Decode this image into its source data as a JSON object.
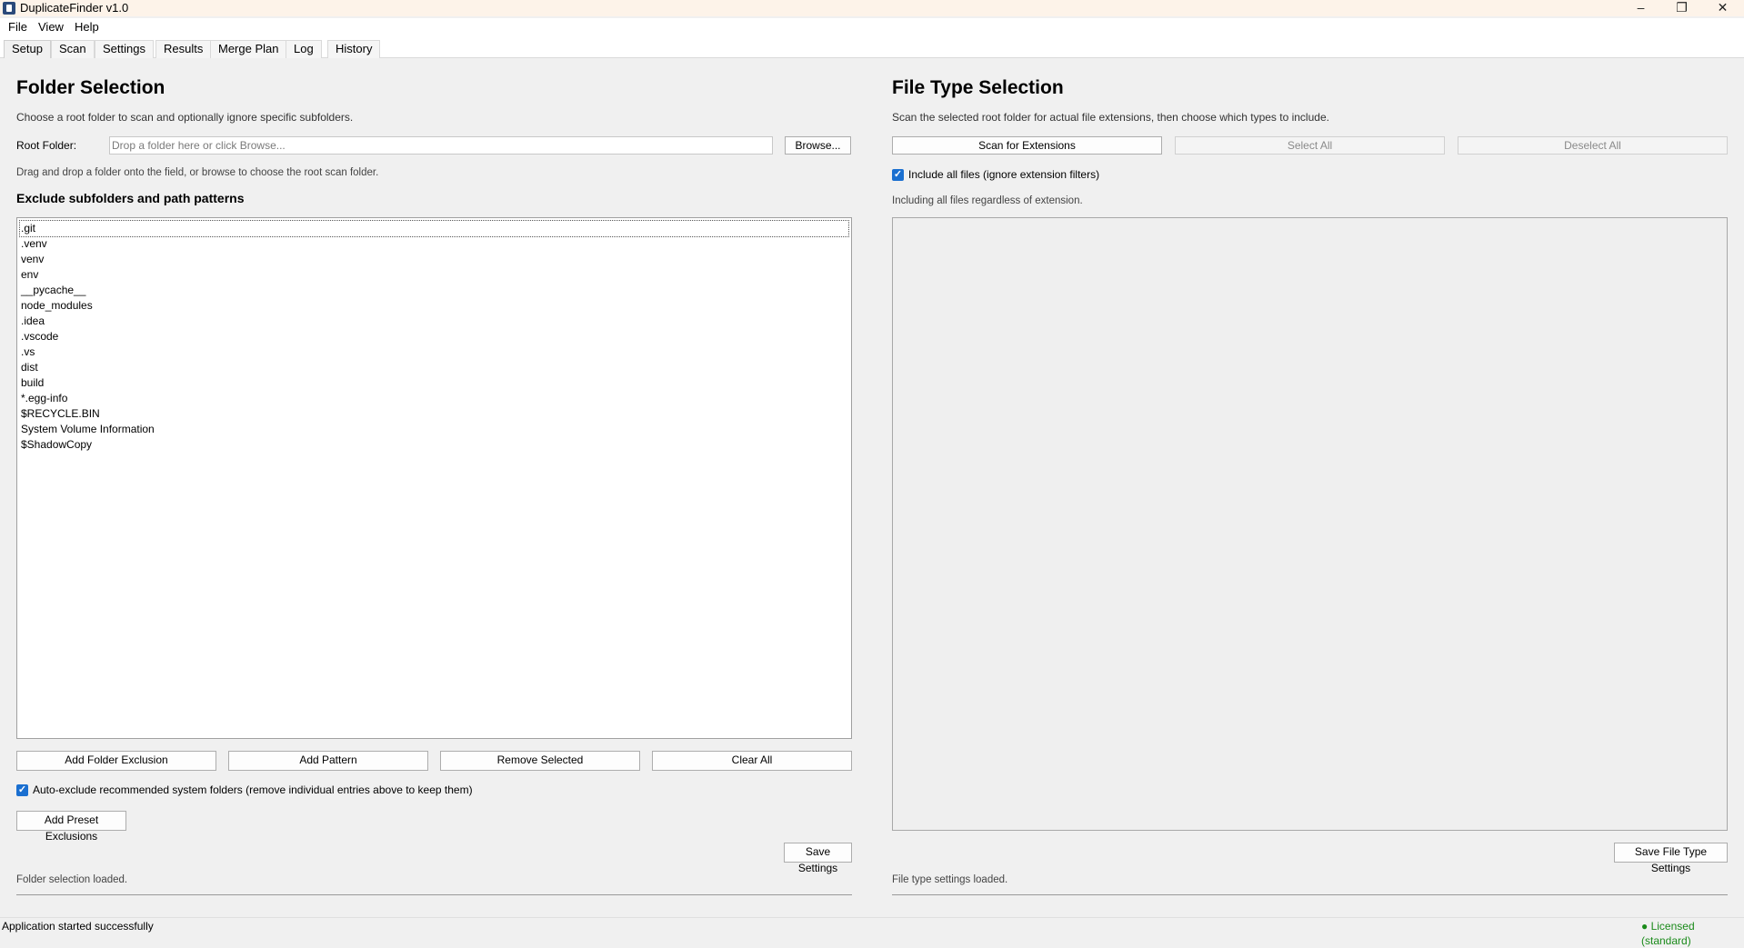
{
  "window": {
    "title": "DuplicateFinder v1.0",
    "minimize": "–",
    "maximize": "❐",
    "close": "✕"
  },
  "menu": {
    "file": "File",
    "view": "View",
    "help": "Help"
  },
  "tabs": [
    {
      "label": "Setup"
    },
    {
      "label": "Scan"
    },
    {
      "label": "Settings"
    },
    {
      "label": "Results"
    },
    {
      "label": "Merge Plan"
    },
    {
      "label": "Log"
    },
    {
      "label": "History"
    }
  ],
  "folder": {
    "heading": "Folder Selection",
    "description": "Choose a root folder to scan and optionally ignore specific subfolders.",
    "root_label": "Root Folder:",
    "root_placeholder": "Drop a folder here or click Browse...",
    "browse": "Browse...",
    "hint": "Drag and drop a folder onto the field, or browse to choose the root scan folder.",
    "exclude_heading": "Exclude subfolders and path patterns",
    "exclusions": [
      ".git",
      ".venv",
      "venv",
      "env",
      "__pycache__",
      "node_modules",
      ".idea",
      ".vscode",
      ".vs",
      "dist",
      "build",
      "*.egg-info",
      "$RECYCLE.BIN",
      "System Volume Information",
      "$ShadowCopy"
    ],
    "add_folder": "Add Folder Exclusion",
    "add_pattern": "Add Pattern",
    "remove_selected": "Remove Selected",
    "clear_all": "Clear All",
    "auto_exclude": "Auto-exclude recommended system folders (remove individual entries above to keep them)",
    "add_preset": "Add Preset Exclusions",
    "save": "Save Settings",
    "status": "Folder selection loaded."
  },
  "filetype": {
    "heading": "File Type Selection",
    "description": "Scan the selected root folder for actual file extensions, then choose which types to include.",
    "scan": "Scan for Extensions",
    "select_all": "Select All",
    "deselect_all": "Deselect All",
    "include_all": "Include all files (ignore extension filters)",
    "info": "Including all files regardless of extension.",
    "save": "Save File Type Settings",
    "status": "File type settings loaded."
  },
  "statusbar": {
    "left": "Application started successfully",
    "right": "● Licensed (standard)"
  },
  "colors": {
    "accent": "#1a6fd0",
    "license": "#1a8a1a"
  }
}
